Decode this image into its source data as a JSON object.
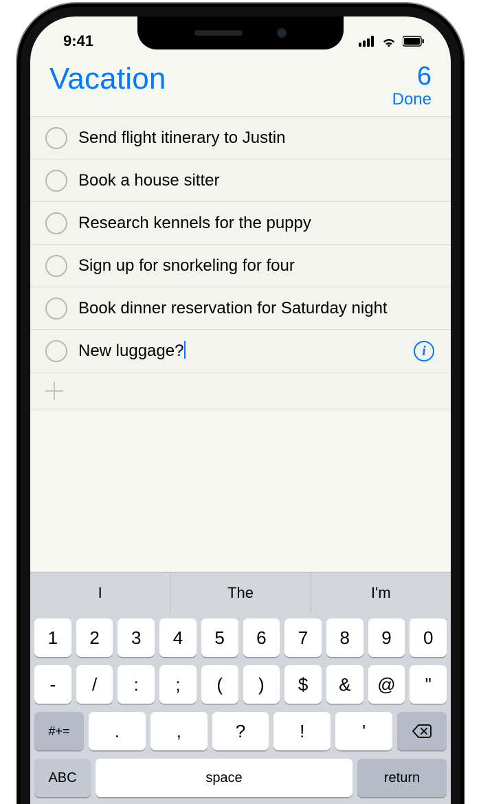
{
  "status": {
    "time": "9:41"
  },
  "header": {
    "title": "Vacation",
    "count": "6",
    "done_label": "Done"
  },
  "reminders": [
    {
      "text": "Send flight itinerary to Justin"
    },
    {
      "text": "Book a house sitter"
    },
    {
      "text": "Research kennels for the puppy"
    },
    {
      "text": "Sign up for snorkeling for four"
    },
    {
      "text": "Book dinner reservation for Saturday night"
    },
    {
      "text": "New luggage?"
    }
  ],
  "active_index": 5,
  "suggestions": [
    "I",
    "The",
    "I'm"
  ],
  "keyboard": {
    "row1": [
      "1",
      "2",
      "3",
      "4",
      "5",
      "6",
      "7",
      "8",
      "9",
      "0"
    ],
    "row2": [
      "-",
      "/",
      ":",
      ";",
      "(",
      ")",
      "$",
      "&",
      "@",
      "\""
    ],
    "row3": [
      ".",
      ",",
      "?",
      "!",
      "'"
    ],
    "sym_label": "#+=",
    "abc_label": "ABC",
    "space_label": "space",
    "return_label": "return"
  }
}
